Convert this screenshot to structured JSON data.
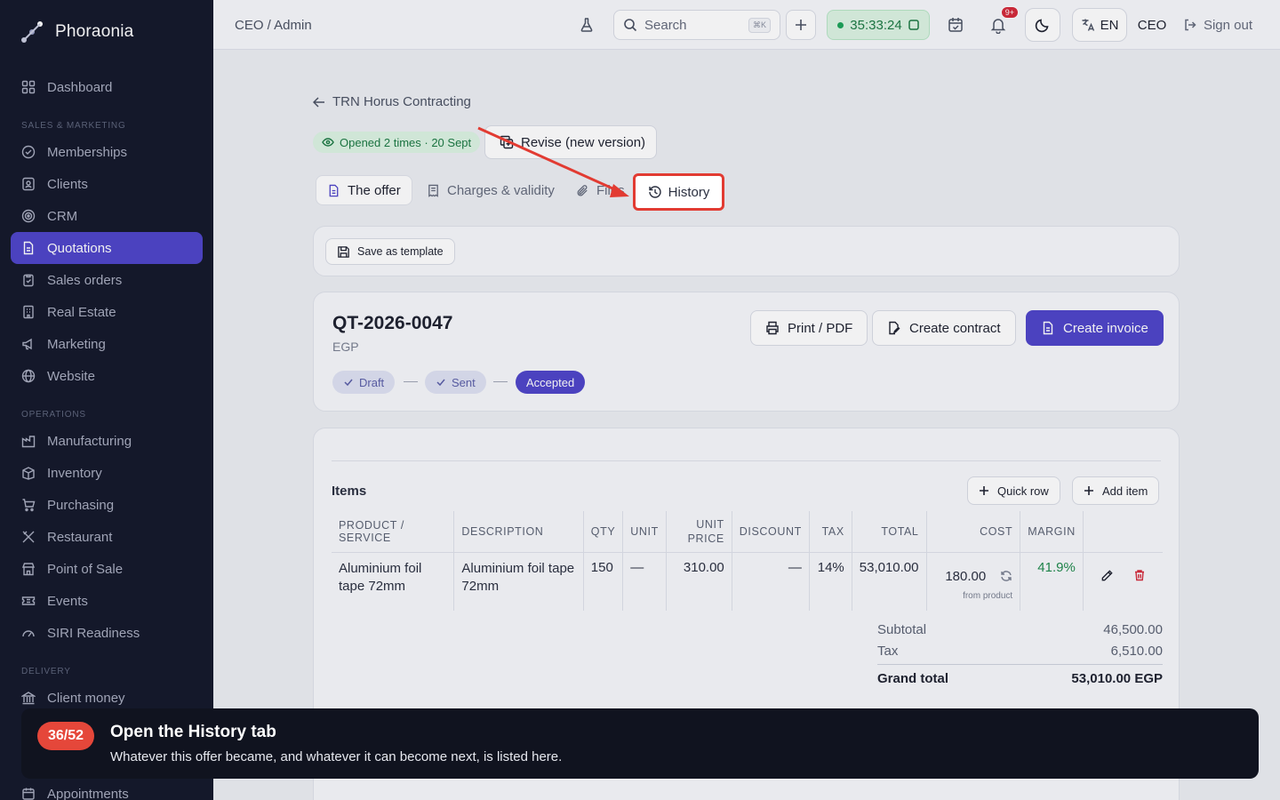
{
  "app": {
    "name": "Phoraonia"
  },
  "sidebar": {
    "top_item": {
      "label": "Dashboard",
      "icon": "dashboard-icon"
    },
    "sections": [
      {
        "title": "SALES & MARKETING",
        "items": [
          {
            "label": "Memberships",
            "icon": "check-circle-icon"
          },
          {
            "label": "Clients",
            "icon": "contact-icon"
          },
          {
            "label": "CRM",
            "icon": "target-icon"
          },
          {
            "label": "Quotations",
            "icon": "document-icon",
            "active": true
          },
          {
            "label": "Sales orders",
            "icon": "clipboard-icon"
          },
          {
            "label": "Real Estate",
            "icon": "building-icon"
          },
          {
            "label": "Marketing",
            "icon": "megaphone-icon"
          },
          {
            "label": "Website",
            "icon": "globe-icon"
          }
        ]
      },
      {
        "title": "OPERATIONS",
        "items": [
          {
            "label": "Manufacturing",
            "icon": "factory-icon"
          },
          {
            "label": "Inventory",
            "icon": "inventory-icon"
          },
          {
            "label": "Purchasing",
            "icon": "cart-icon"
          },
          {
            "label": "Restaurant",
            "icon": "utensils-icon"
          },
          {
            "label": "Point of Sale",
            "icon": "store-icon"
          },
          {
            "label": "Events",
            "icon": "ticket-icon"
          },
          {
            "label": "SIRI Readiness",
            "icon": "gauge-icon"
          }
        ]
      },
      {
        "title": "DELIVERY",
        "items": [
          {
            "label": "Client money",
            "icon": "bank-icon"
          },
          {
            "label": "Appointments",
            "icon": "calendar-icon"
          }
        ]
      }
    ]
  },
  "topbar": {
    "breadcrumb": "CEO / Admin",
    "search_placeholder": "Search",
    "search_shortcut": "⌘K",
    "timer": "35:33:24",
    "notifications_badge": "9+",
    "language": "EN",
    "role": "CEO",
    "sign_out": "Sign out"
  },
  "page": {
    "back_label": "TRN Horus Contracting",
    "opened_pill": "Opened 2 times · 20 Sept",
    "revise_button": "Revise (new version)",
    "tabs": [
      "The offer",
      "Charges & validity",
      "Files",
      "History"
    ],
    "save_template": "Save as template"
  },
  "quote": {
    "number": "QT-2026-0047",
    "currency": "EGP",
    "actions": {
      "print": "Print / PDF",
      "contract": "Create contract",
      "invoice": "Create invoice"
    },
    "steps": [
      "Draft",
      "Sent",
      "Accepted"
    ]
  },
  "items": {
    "title": "Items",
    "quick_row": "Quick row",
    "add_item": "Add item",
    "columns": [
      "PRODUCT / SERVICE",
      "DESCRIPTION",
      "QTY",
      "UNIT",
      "UNIT PRICE",
      "DISCOUNT",
      "TAX",
      "TOTAL",
      "COST",
      "MARGIN"
    ],
    "rows": [
      {
        "product": "Aluminium foil tape 72mm",
        "description": "Aluminium foil tape 72mm",
        "qty": "150",
        "unit": "—",
        "unit_price": "310.00",
        "discount": "—",
        "tax": "14%",
        "total": "53,010.00",
        "cost": "180.00",
        "cost_note": "from product",
        "margin": "41.9%"
      }
    ],
    "totals": {
      "subtotal_label": "Subtotal",
      "subtotal": "46,500.00",
      "tax_label": "Tax",
      "tax": "6,510.00",
      "grand_label": "Grand total",
      "grand": "53,010.00 EGP"
    }
  },
  "tour": {
    "step": "36/52",
    "title": "Open the History tab",
    "description": "Whatever this offer became, and whatever it can become next, is listed here."
  },
  "colors": {
    "accent": "#4f46c9",
    "sidebar": "#15192b",
    "highlight": "#e23b32",
    "success": "#1c7a43",
    "margin": "#1f8a4c",
    "danger": "#d42a3a"
  }
}
